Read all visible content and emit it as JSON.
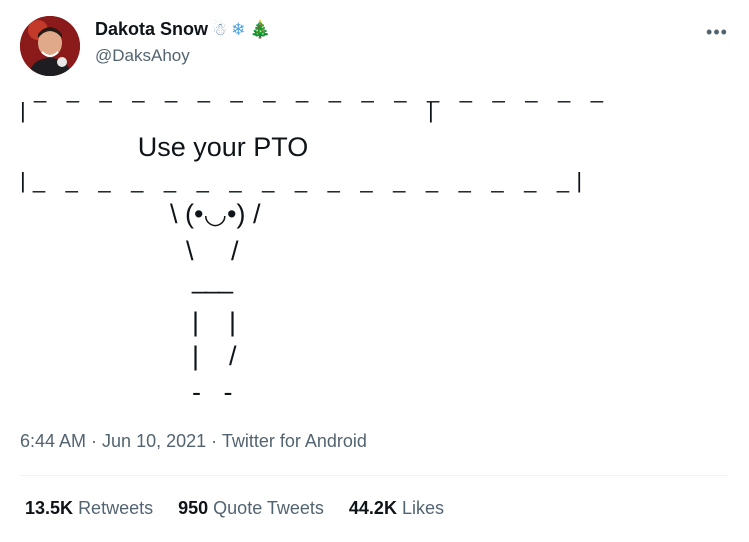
{
  "author": {
    "name": "Dakota Snow",
    "emojis": [
      "☃",
      "❄",
      "🎄"
    ],
    "handle": "@DaksAhoy"
  },
  "more_icon": "more-horizontal-icon",
  "more_glyph": "•••",
  "sign": {
    "top_dashes": "_ _ _ _ _ _ _ _ _ _ _ _ _ _ _ _ _ _",
    "left_bar_top": "|",
    "right_bar_top": "|",
    "text": "Use your PTO",
    "bottom_line": "|_ _ _ _ _ _ _ _ _ _ _ _ _ _ _ _ _|"
  },
  "figure": {
    "line1": "\\ (•◡•) /",
    "line2": "\\     /",
    "line3": "___",
    "line4": "|    |",
    "line5": "|    /",
    "line6": "-   -"
  },
  "meta": {
    "time": "6:44 AM",
    "sep1": " · ",
    "date": "Jun 10, 2021",
    "sep2": " · ",
    "source": "Twitter for Android"
  },
  "stats": [
    {
      "num": "13.5K",
      "label": "Retweets"
    },
    {
      "num": "950",
      "label": "Quote Tweets"
    },
    {
      "num": "44.2K",
      "label": "Likes"
    }
  ]
}
